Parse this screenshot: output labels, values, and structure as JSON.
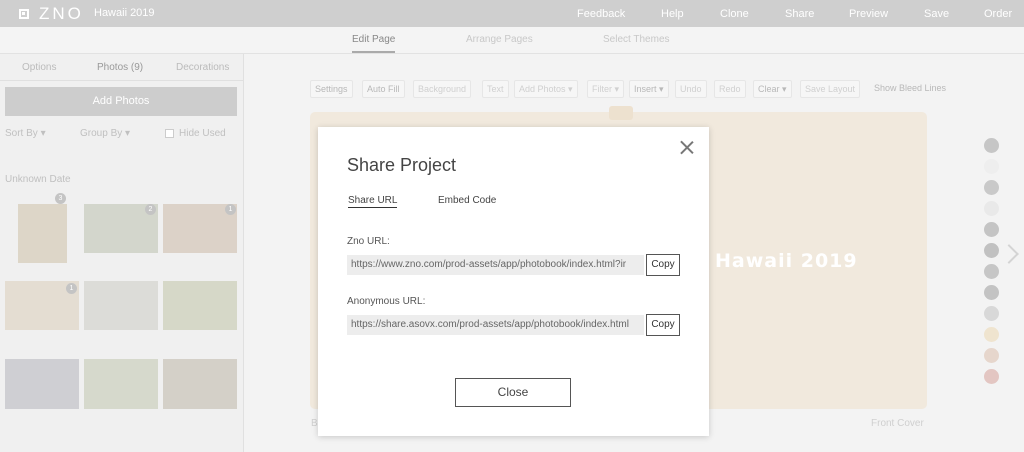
{
  "app": {
    "logo_text": "ZNO",
    "project_title": "Hawaii 2019",
    "nav": [
      "Feedback",
      "Help",
      "Clone",
      "Share",
      "Preview",
      "Save",
      "Order"
    ]
  },
  "subnav": [
    "Edit Page",
    "Arrange Pages",
    "Select Themes"
  ],
  "left_panel": {
    "tabs": [
      "Options",
      "Photos (9)",
      "Decorations"
    ],
    "add_photos": "Add Photos",
    "sort_by": "Sort By",
    "group_by": "Group By",
    "hide_used": "Hide Used",
    "date_group": "Unknown Date",
    "badges": [
      "3",
      "2",
      "1",
      "1"
    ]
  },
  "toolbar": [
    "Settings",
    "Auto Fill",
    "Background",
    "Text",
    "Add Photos ▾",
    "Filter ▾",
    "Insert ▾",
    "Undo",
    "Redo",
    "Clear ▾",
    "Save Layout",
    "Show Bleed Lines"
  ],
  "canvas": {
    "book_title": "Hawaii 2019",
    "front_cover": "Front Cover",
    "back_partial": "B"
  },
  "swatches": [
    "#c6c6c6",
    "#eeeeee",
    "#c9c9c9",
    "#e9e9e9",
    "#c4c4c4",
    "#c1c1c1",
    "#c6c6c6",
    "#c3c3c3",
    "#d8d8d8",
    "#efe4cf",
    "#e6d6cc",
    "#e3c6c2"
  ],
  "modal": {
    "title": "Share Project",
    "tabs": [
      "Share URL",
      "Embed Code"
    ],
    "zno_url_label": "Zno URL:",
    "zno_url": "https://www.zno.com/prod-assets/app/photobook/index.html?ir",
    "anon_url_label": "Anonymous URL:",
    "anon_url": "https://share.asovx.com/prod-assets/app/photobook/index.html",
    "copy": "Copy",
    "close": "Close"
  }
}
